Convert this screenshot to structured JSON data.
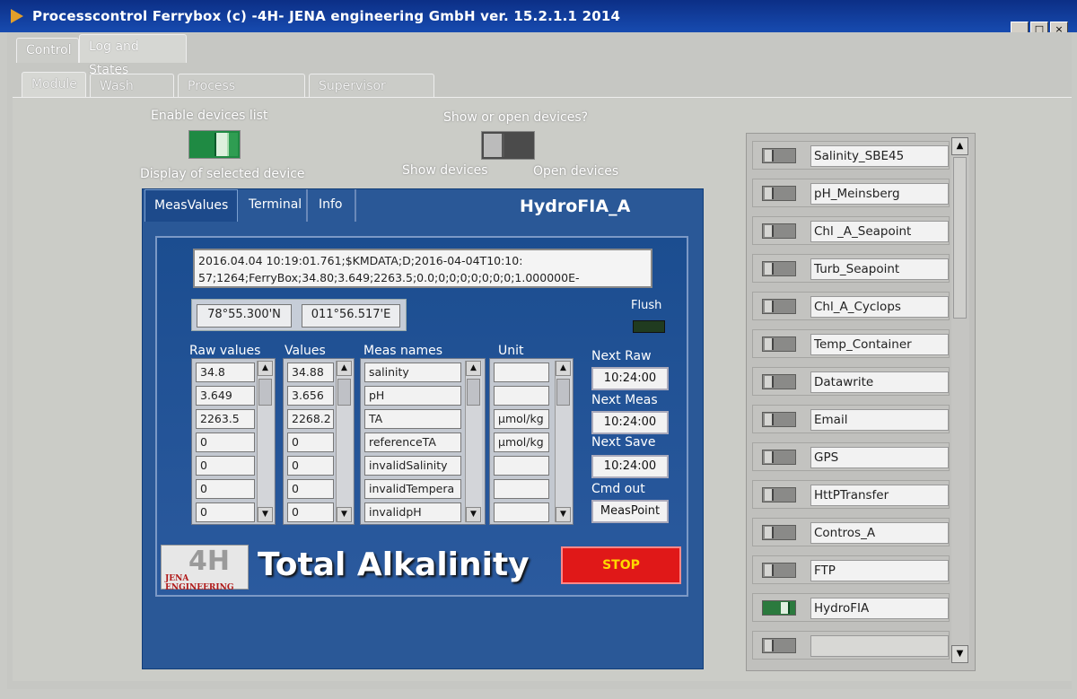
{
  "window": {
    "title": "Processcontrol Ferrybox  (c) -4H- JENA engineering GmbH ver. 15.2.1.1  2014"
  },
  "top_tabs": [
    "Control",
    "Log and States"
  ],
  "sub_tabs": [
    "Module",
    "Wash times",
    "Process parameter",
    "Supervisor actions"
  ],
  "labels": {
    "enable_devices": "Enable devices list",
    "display_selected": "Display of selected device",
    "show_or_open": "Show or open devices?",
    "show_devices": "Show devices",
    "open_devices": "Open devices"
  },
  "device_panel": {
    "tabs": [
      "MeasValues",
      "Terminal",
      "Info"
    ],
    "device_name": "HydroFIA_A",
    "message_line1": "2016.04.04 10:19:01.761;$KMDATA;D;2016-04-04T10:10:",
    "message_line2": "57;1264;FerryBox;34.80;3.649;2263.5;0.0;0;0;0;0;0;0;0;1.000000E-",
    "latitude": "78°55.300'N",
    "longitude": "011°56.517'E",
    "flush_label": "Flush",
    "col_headers": {
      "raw": "Raw values",
      "values": "Values",
      "names": "Meas names",
      "unit": "Unit"
    },
    "raw_values": [
      "34.8",
      "3.649",
      "2263.5",
      "0",
      "0",
      "0",
      "0"
    ],
    "values": [
      "34.88",
      "3.656",
      "2268.2",
      "0",
      "0",
      "0",
      "0"
    ],
    "meas_names": [
      "salinity",
      "pH",
      "TA",
      "referenceTA",
      "invalidSalinity",
      "invalidTempera",
      "invalidpH"
    ],
    "units": [
      "",
      "",
      "µmol/kg",
      "µmol/kg",
      "",
      "",
      ""
    ],
    "next_raw_label": "Next Raw",
    "next_raw": "10:24:00",
    "next_meas_label": "Next Meas",
    "next_meas": "10:24:00",
    "next_save_label": "Next Save",
    "next_save": "10:24:00",
    "cmd_out_label": "Cmd out",
    "cmd_out": "MeasPoint",
    "logo_big": "4H",
    "logo_small": "JENA ENGINEERING",
    "big_title": "Total Alkalinity",
    "stop_label": "STOP"
  },
  "devices": [
    {
      "name": "Salinity_SBE45",
      "on": false
    },
    {
      "name": "pH_Meinsberg",
      "on": false
    },
    {
      "name": "Chl _A_Seapoint",
      "on": false
    },
    {
      "name": "Turb_Seapoint",
      "on": false
    },
    {
      "name": "Chl_A_Cyclops",
      "on": false
    },
    {
      "name": "Temp_Container",
      "on": false
    },
    {
      "name": "Datawrite",
      "on": false
    },
    {
      "name": "Email",
      "on": false
    },
    {
      "name": "GPS",
      "on": false
    },
    {
      "name": "HttPTransfer",
      "on": false
    },
    {
      "name": "Contros_A",
      "on": false
    },
    {
      "name": "FTP",
      "on": false
    },
    {
      "name": "HydroFIA",
      "on": true
    },
    {
      "name": "",
      "on": false
    }
  ]
}
